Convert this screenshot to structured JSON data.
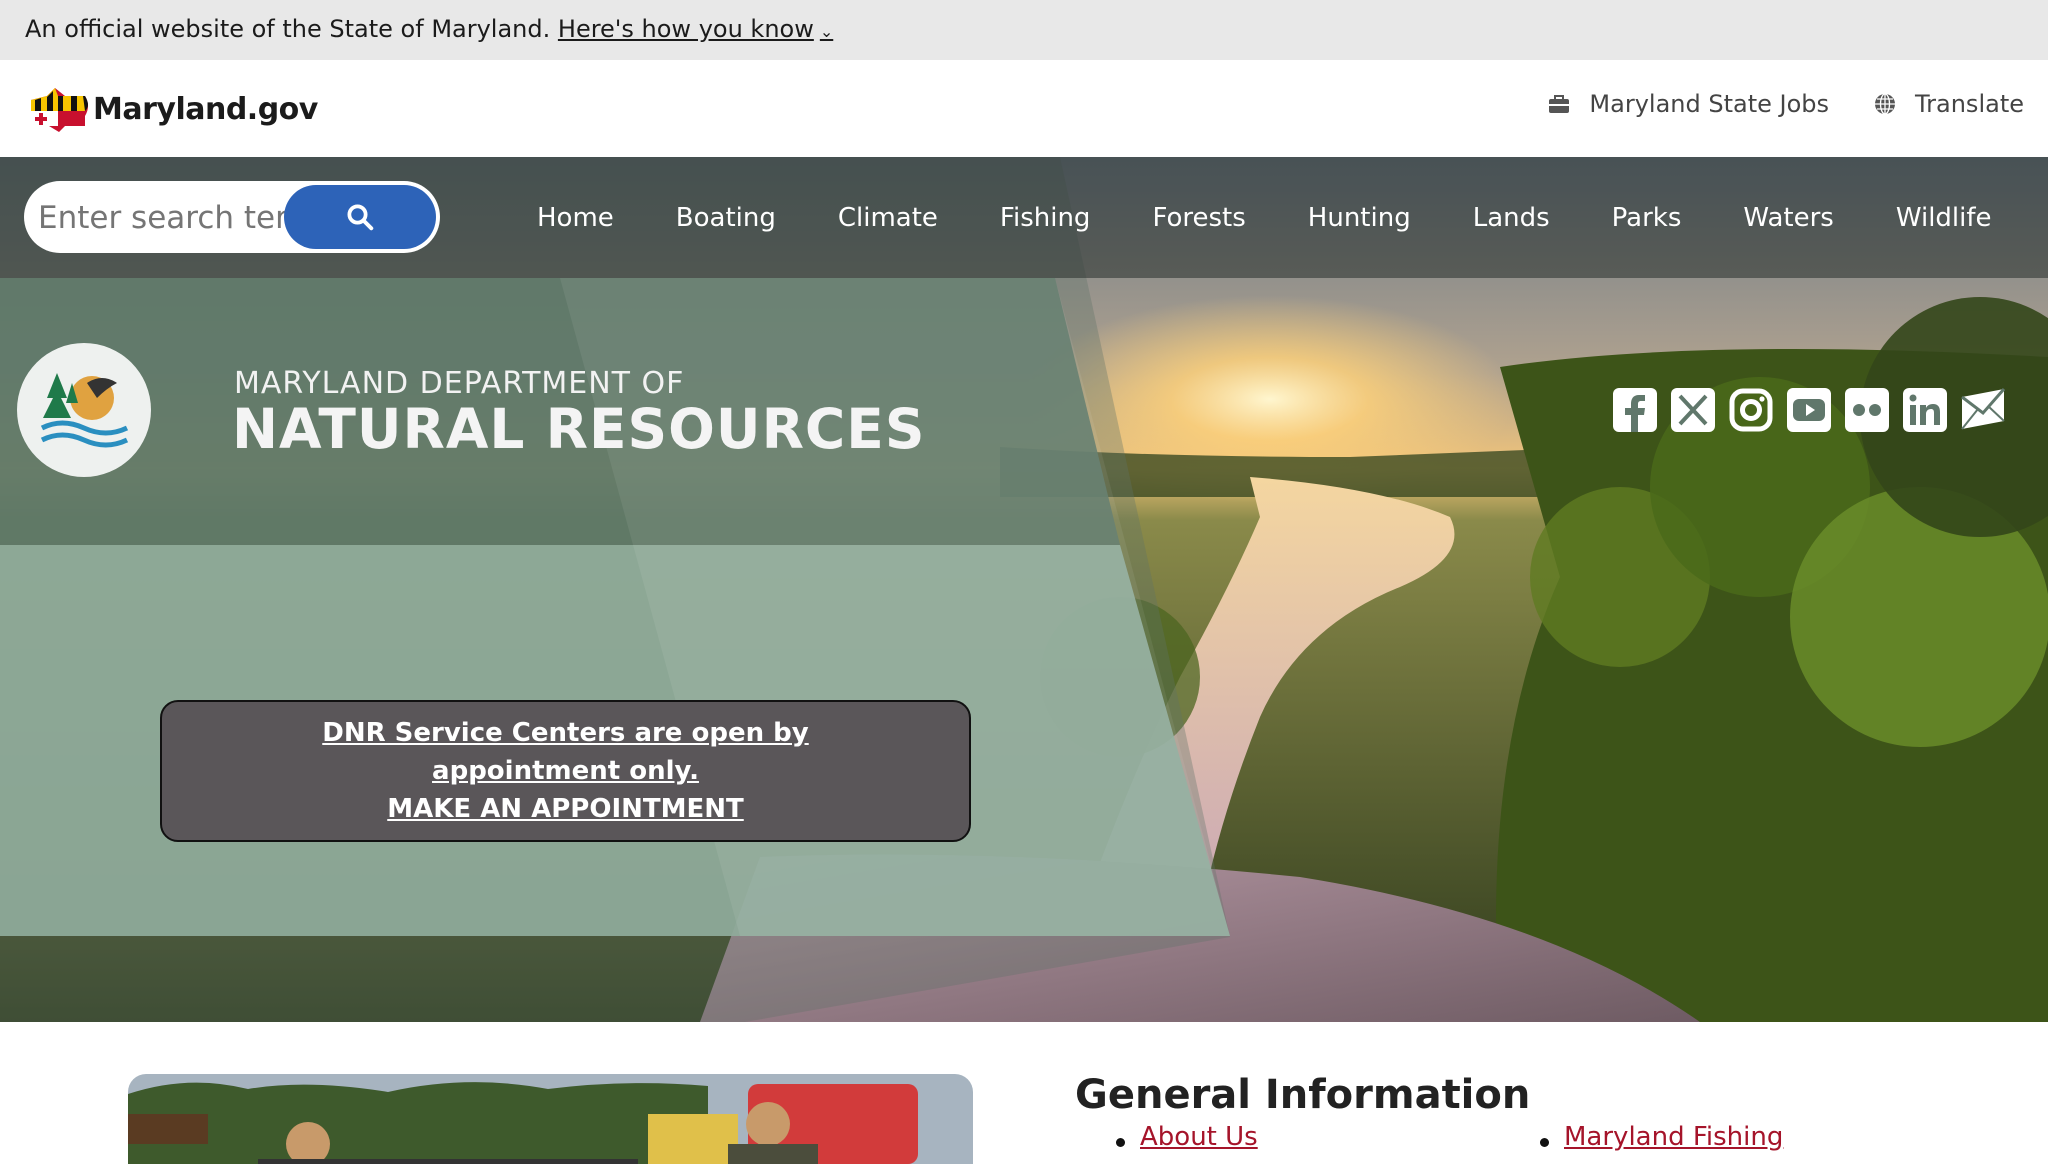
{
  "official_banner": {
    "text": "An official website of the State of Maryland.",
    "link": "Here's how you know",
    "chevron_icon": "chevron-down-icon"
  },
  "header": {
    "logo_text": "Maryland.gov",
    "jobs_link": "Maryland State Jobs",
    "jobs_icon": "briefcase-icon",
    "translate_link": "Translate",
    "translate_icon": "globe-icon"
  },
  "search": {
    "placeholder": "Enter search terms",
    "button_icon": "search-icon"
  },
  "nav": {
    "items": [
      "Home",
      "Boating",
      "Climate",
      "Fishing",
      "Forests",
      "Hunting",
      "Lands",
      "Parks",
      "Waters",
      "Wildlife"
    ]
  },
  "department": {
    "line1": "MARYLAND DEPARTMENT OF",
    "line2": "NATURAL RESOURCES"
  },
  "social": [
    "facebook-icon",
    "x-twitter-icon",
    "instagram-icon",
    "youtube-icon",
    "flickr-icon",
    "linkedin-icon",
    "email-icon"
  ],
  "notice": {
    "line1": "DNR Service Centers are open by appointment only.",
    "line2": "MAKE AN APPOINTMENT"
  },
  "general_info": {
    "title": "General Information",
    "col1": [
      "About Us"
    ],
    "col2": [
      "Maryland Fishing"
    ]
  },
  "colors": {
    "accent_blue": "#2d63b8",
    "link_red": "#a5142a",
    "panel_green": "#8fab9b",
    "notice_bg": "#5a5659"
  }
}
